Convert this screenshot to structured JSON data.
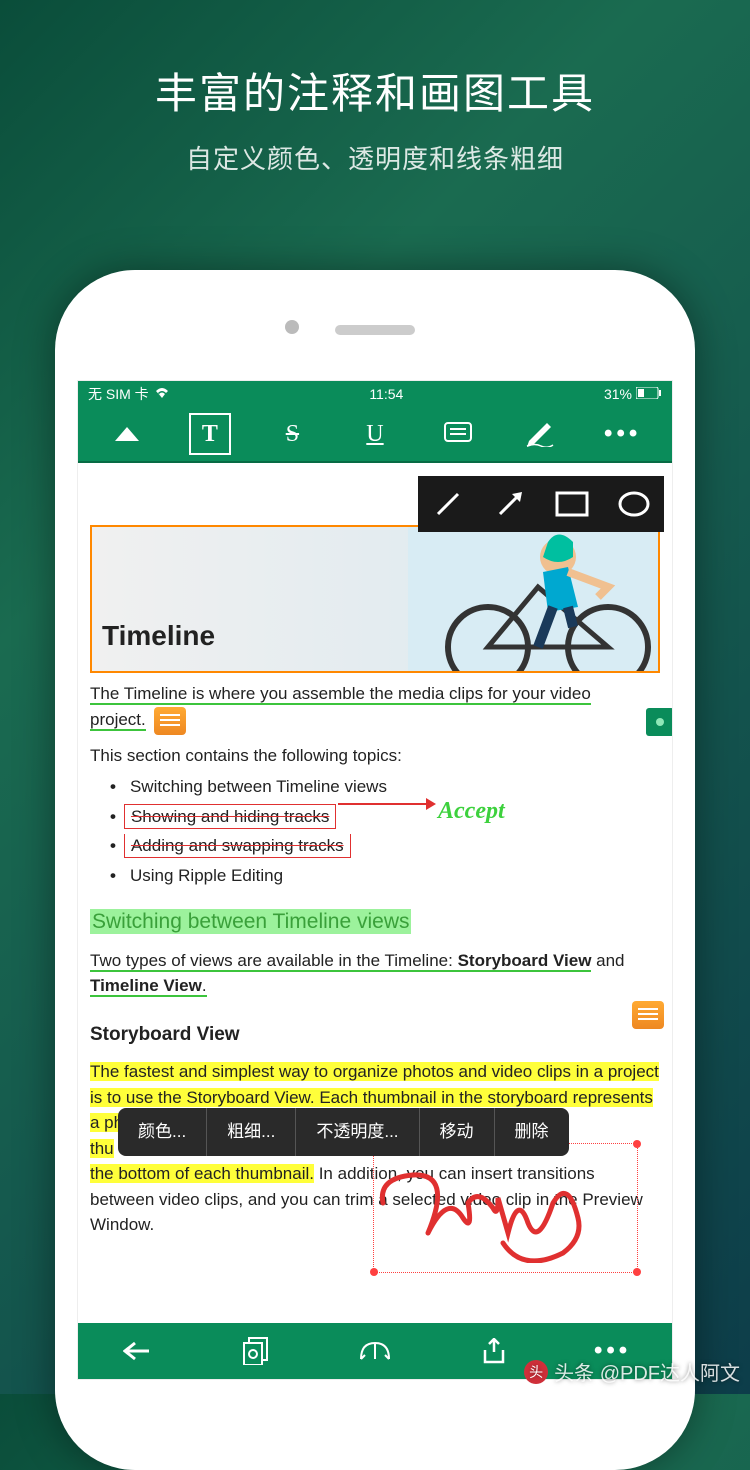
{
  "promo": {
    "title": "丰富的注释和画图工具",
    "subtitle": "自定义颜色、透明度和线条粗细"
  },
  "status": {
    "sim": "无 SIM 卡",
    "time": "11:54",
    "battery": "31%"
  },
  "toolbar": {
    "t": "T",
    "s": "S",
    "u": "U"
  },
  "doc": {
    "h1": "Timeline",
    "p1a": "The Timeline is where you assemble the media clips for your video ",
    "p1b": "project.",
    "p2": "This section contains the following topics:",
    "bullets": [
      "Switching between Timeline views",
      "Showing and hiding tracks",
      "Adding and swapping tracks",
      "Using Ripple Editing"
    ],
    "accept": "Accept",
    "h2": "Switching between Timeline views",
    "p3a": "Two types of views are available in the Timeline: ",
    "p3b": "Storyboard View",
    "p3c": " and ",
    "p3d": "Timeline View",
    "p3e": ".",
    "h3": "Storyboard View",
    "p4a": "The fastest and simplest way to organize photos and video clips in a project is to use the Storyboard View. Each thumbnail in the storyboard represents a photo, video clip, or a transition. Thumbnails are shown in t",
    "p4b": "thu",
    "p4c": "the bottom of each thumbnail.",
    "p4d": " In addition, you can insert transitions between video clips, and you can trim a selected video clip in the Preview Window."
  },
  "context": {
    "color": "颜色...",
    "weight": "粗细...",
    "opacity": "不透明度...",
    "move": "移动",
    "delete": "删除"
  },
  "watermark": "头条 @PDF达人阿文"
}
